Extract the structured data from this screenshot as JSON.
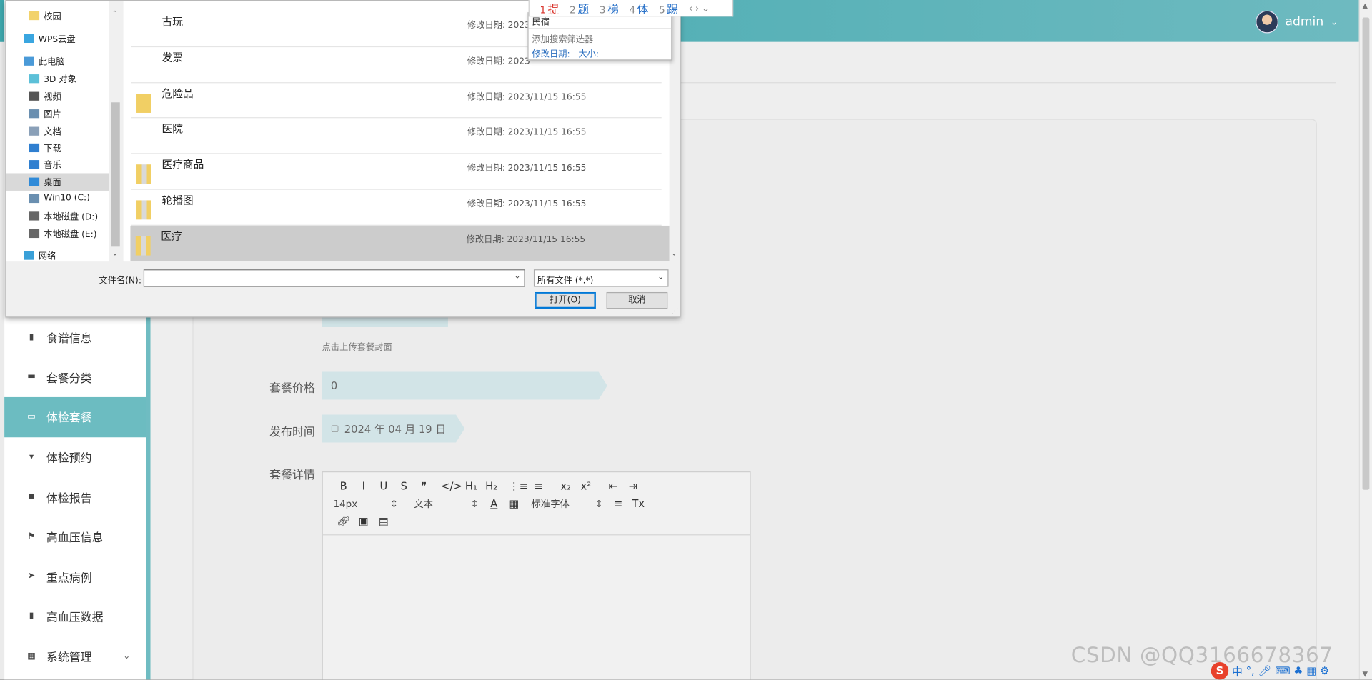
{
  "header": {
    "username": "admin"
  },
  "sidebar": {
    "items": [
      {
        "label": "食谱信息",
        "icon": "clipboard-icon",
        "active": false
      },
      {
        "label": "套餐分类",
        "icon": "ticket-icon",
        "active": false
      },
      {
        "label": "体检套餐",
        "icon": "card-icon",
        "active": true
      },
      {
        "label": "体检预约",
        "icon": "stamp-icon",
        "active": false
      },
      {
        "label": "体检报告",
        "icon": "briefcase-icon",
        "active": false
      },
      {
        "label": "高血压信息",
        "icon": "flag-icon",
        "active": false
      },
      {
        "label": "重点病例",
        "icon": "send-icon",
        "active": false
      },
      {
        "label": "高血压数据",
        "icon": "bar-chart-icon",
        "active": false
      },
      {
        "label": "系统管理",
        "icon": "grid-icon",
        "active": false
      }
    ]
  },
  "form": {
    "cover_hint": "点击上传套餐封面",
    "price_label": "套餐价格",
    "price_value": "0",
    "publish_label": "发布时间",
    "publish_value": "2024 年 04 月 19 日",
    "detail_label": "套餐详情",
    "editor": {
      "font_size": "14px",
      "block_type": "文本",
      "font_family": "标准字体",
      "row1_buttons": [
        "B",
        "I",
        "U",
        "S",
        "❞",
        "</>",
        "H₁",
        "H₂",
        "⋮≡",
        "≡",
        "x₂",
        "x²",
        "⇤",
        "⇥"
      ],
      "row2_buttons": [
        "A",
        "▦",
        "≡",
        "Tx"
      ],
      "row3_buttons": [
        "link-icon",
        "image-icon",
        "video-icon"
      ]
    }
  },
  "watermark": "CSDN @QQ3166678367",
  "file_dialog": {
    "nav_items": [
      {
        "label": "校园",
        "icon": "folder-icon",
        "indent": 2
      },
      {
        "label": "WPS云盘",
        "icon": "cloud-icon",
        "indent": 1
      },
      {
        "label": "此电脑",
        "icon": "computer-icon",
        "indent": 1
      },
      {
        "label": "3D 对象",
        "icon": "cube-icon",
        "indent": 2
      },
      {
        "label": "视频",
        "icon": "video-icon",
        "indent": 2
      },
      {
        "label": "图片",
        "icon": "picture-icon",
        "indent": 2
      },
      {
        "label": "文档",
        "icon": "document-icon",
        "indent": 2
      },
      {
        "label": "下载",
        "icon": "download-icon",
        "indent": 2
      },
      {
        "label": "音乐",
        "icon": "music-icon",
        "indent": 2
      },
      {
        "label": "桌面",
        "icon": "desktop-icon",
        "indent": 2,
        "selected": true
      },
      {
        "label": "Win10 (C:)",
        "icon": "system-drive-icon",
        "indent": 2
      },
      {
        "label": "本地磁盘 (D:)",
        "icon": "drive-icon",
        "indent": 2
      },
      {
        "label": "本地磁盘 (E:)",
        "icon": "drive-icon",
        "indent": 2
      },
      {
        "label": "网络",
        "icon": "network-icon",
        "indent": 1
      }
    ],
    "files": [
      {
        "name": "古玩",
        "date_label": "修改日期:",
        "date": "2023",
        "icon": "none"
      },
      {
        "name": "发票",
        "date_label": "修改日期:",
        "date": "2023",
        "icon": "none"
      },
      {
        "name": "危险品",
        "date_label": "修改日期:",
        "date": "2023/11/15 16:55",
        "icon": "folder"
      },
      {
        "name": "医院",
        "date_label": "修改日期:",
        "date": "2023/11/15 16:55",
        "icon": "none"
      },
      {
        "name": "医疗商品",
        "date_label": "修改日期:",
        "date": "2023/11/15 16:55",
        "icon": "folder-doc"
      },
      {
        "name": "轮播图",
        "date_label": "修改日期:",
        "date": "2023/11/15 16:55",
        "icon": "folder-img"
      },
      {
        "name": "医疗",
        "date_label": "修改日期:",
        "date": "2023/11/15 16:55",
        "icon": "folder-img",
        "selected": true
      }
    ],
    "filename_label": "文件名(N):",
    "filename_value": "",
    "filetype_value": "所有文件 (*.*)",
    "open_label": "打开(O)",
    "cancel_label": "取消"
  },
  "search_dropdown": {
    "query": "民宿",
    "add_filter": "添加搜索筛选器",
    "filter_date": "修改日期:",
    "filter_size": "大小:"
  },
  "ime": {
    "candidates": [
      {
        "num": "1",
        "text": "提"
      },
      {
        "num": "2",
        "text": "题"
      },
      {
        "num": "3",
        "text": "梯"
      },
      {
        "num": "4",
        "text": "体"
      },
      {
        "num": "5",
        "text": "踢"
      }
    ]
  },
  "tray": {
    "label": "中"
  }
}
